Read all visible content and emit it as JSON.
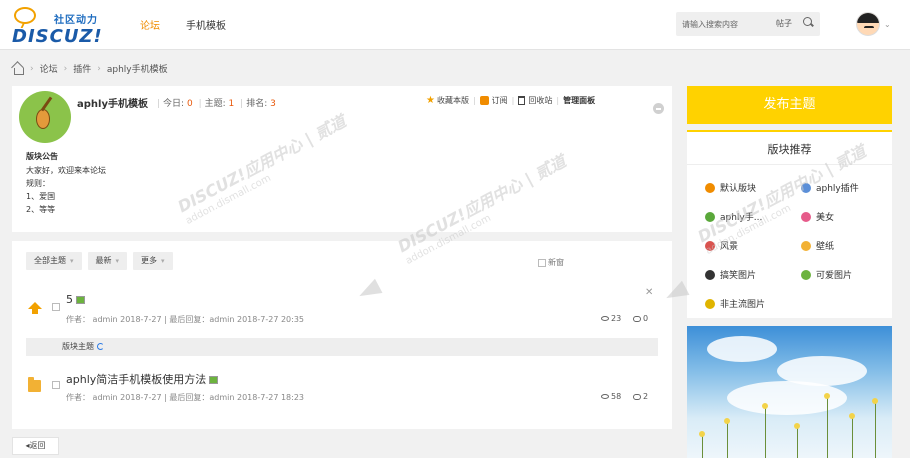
{
  "header": {
    "logo_cn": "社区动力",
    "logo_en": "DISCUZ!",
    "nav": [
      "论坛",
      "手机模板"
    ],
    "nav_active": 0,
    "search": {
      "placeholder": "请输入搜索内容",
      "type": "帖子",
      "icon": "search-icon"
    },
    "avatar_icon": "avatar",
    "accent_color": "#f08c00"
  },
  "breadcrumb": {
    "items": [
      "论坛",
      "插件",
      "aphly手机模板"
    ],
    "separator": "›"
  },
  "forum": {
    "name": "aphly手机模板",
    "today_label": "今日:",
    "today": "0",
    "threads_label": "主题:",
    "threads": "1",
    "rank_label": "排名:",
    "rank": "3",
    "actions": [
      "收藏本版",
      "订阅",
      "回收站",
      "管理面板"
    ],
    "notice_title": "版块公告",
    "notice_lines": [
      "大家好，欢迎来本论坛",
      "规则：",
      "1、爱国",
      "2、等等"
    ]
  },
  "filters": {
    "items": [
      "全部主题",
      "最新",
      "更多"
    ],
    "new_window": "新窗"
  },
  "threads": [
    {
      "title": "5",
      "author_label": "作者：",
      "author": "admin",
      "date": "2018-7-27",
      "last_label": "最后回复：",
      "last_user": "admin",
      "last_time": "2018-7-27 20:35",
      "views": "23",
      "replies": "0",
      "icon": "pin-up-icon"
    },
    {
      "title": "aphly简洁手机模板使用方法",
      "author_label": "作者：",
      "author": "admin",
      "date": "2018-7-27",
      "last_label": "最后回复：",
      "last_user": "admin",
      "last_time": "2018-7-27 18:23",
      "views": "58",
      "replies": "2",
      "icon": "folder-icon"
    }
  ],
  "section_label": "版块主题",
  "back_label": "返回",
  "sidebar": {
    "post_button": "发布主题",
    "post_color": "#ffd200",
    "rec_title": "版块推荐",
    "subforums": [
      {
        "label": "默认版块",
        "color": "#f08c00"
      },
      {
        "label": "aphly插件",
        "color": "#5b8fd8"
      },
      {
        "label": "aphly手...",
        "color": "#5aa83a"
      },
      {
        "label": "美女",
        "color": "#e65b8a"
      },
      {
        "label": "风景",
        "color": "#d9534f"
      },
      {
        "label": "壁纸",
        "color": "#f2b134"
      },
      {
        "label": "搞笑图片",
        "color": "#333333"
      },
      {
        "label": "可爱图片",
        "color": "#6cb33e"
      },
      {
        "label": "非主流图片",
        "color": "#e0b400"
      }
    ]
  },
  "watermark": {
    "brand": "DISCUZ!应用中心 | 贰道",
    "url": "addon.dismall.com"
  }
}
